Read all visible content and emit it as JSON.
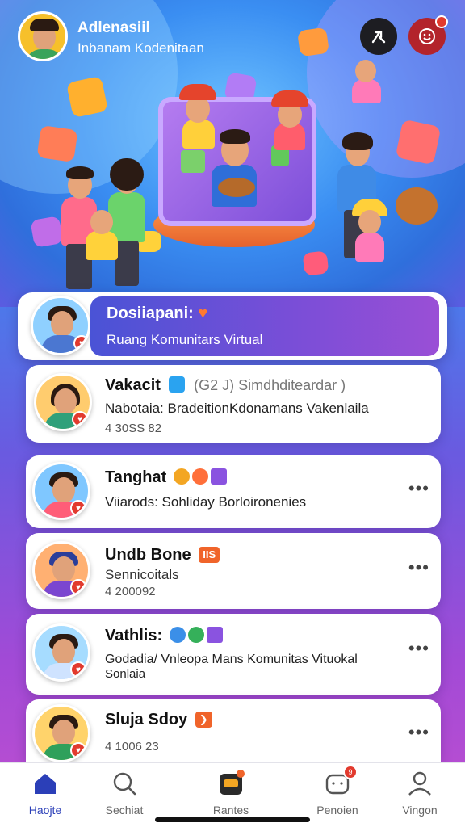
{
  "header": {
    "title": "Adlenasiil",
    "subtitle": "Inbanam Kodenitaan"
  },
  "featured": {
    "title": "Dosiiapani:",
    "heart": "♥",
    "subtitle": "Ruang Komunitars Virtual"
  },
  "posts": [
    {
      "name": "Vakacit",
      "extra": "(G2 J)  Simdhditeardar )",
      "line1": "Nabotaia: BradeitionKdonamans Vakenlaila",
      "meta": "4 30SS 82"
    },
    {
      "name": "Tanghat",
      "line1": "Viiarods: Sohliday Borloironenies",
      "more": "•••"
    },
    {
      "name": "Undb Bone",
      "tag": "IIS",
      "line1": "Sennicoitals",
      "meta": "4 200092",
      "more": "•••"
    },
    {
      "name": "Vathlis:",
      "line1": "Godadia/ Vnleopa Mans Komunitas Vituokal",
      "line2": "Sonlaia",
      "more": "•••"
    },
    {
      "name": "Sluja Sdoy",
      "tag": "❯",
      "meta": "4 1006 23",
      "more": "•••"
    }
  ],
  "tabs": [
    {
      "label": "Haojte",
      "icon": "home-icon",
      "active": true
    },
    {
      "label": "Sechiat",
      "icon": "search-icon"
    },
    {
      "label": "Rantes",
      "icon": "rooms-icon"
    },
    {
      "label": "Penoien",
      "icon": "chat-icon",
      "badge": "9"
    },
    {
      "label": "Vingon",
      "icon": "profile-icon"
    }
  ],
  "colors": {
    "accent": "#5a4fd8",
    "badge": "#e23a2e",
    "home_active": "#2b3fb8"
  }
}
